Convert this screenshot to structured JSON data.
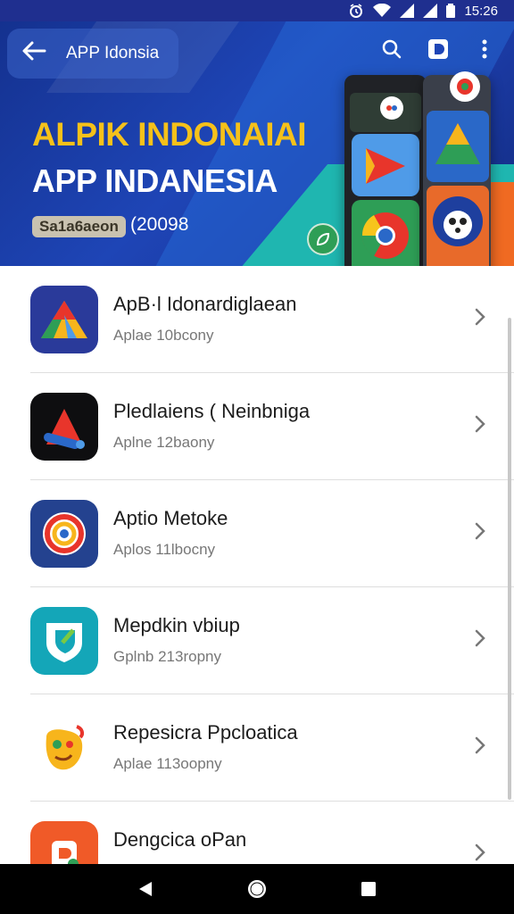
{
  "status_bar": {
    "time": "15:26"
  },
  "header": {
    "title": "APP Idonsia",
    "icons": [
      "back-arrow-icon",
      "search-icon",
      "bookmark-icon",
      "more-vert-icon"
    ]
  },
  "hero": {
    "title_line1": "ALPIK INDONAIAI",
    "title_line2": "APP INDANESIA",
    "badge": "Sa1a6aeon",
    "count": "(20098"
  },
  "apps": [
    {
      "name": "ApB·l Idonardiglaean",
      "subtitle": "Aplae 10bcony",
      "icon": "triangle-logo-icon",
      "color": "#2a3a9a"
    },
    {
      "name": "Pledlaiens ( Neinbniga",
      "subtitle": "Aplne 12baony",
      "icon": "wrench-logo-icon",
      "color": "#0e0e10"
    },
    {
      "name": "Aptio Metoke",
      "subtitle": "Aplos 11lbocny",
      "icon": "swirl-logo-icon",
      "color": "#24428f"
    },
    {
      "name": "Mepdkin vbiup",
      "subtitle": "Gplnb 213ropny",
      "icon": "shield-logo-icon",
      "color": "#14a6b8"
    },
    {
      "name": "Repesicra Ppcloatica",
      "subtitle": "Aplae 113oopny",
      "icon": "face-logo-icon",
      "color": "#ffffff"
    },
    {
      "name": "Dengcica oPan",
      "subtitle": "",
      "icon": "orange-logo-icon",
      "color": "#f05a28"
    }
  ],
  "nav": {
    "icons": [
      "back-triangle-icon",
      "home-circle-icon",
      "recents-square-icon"
    ]
  }
}
